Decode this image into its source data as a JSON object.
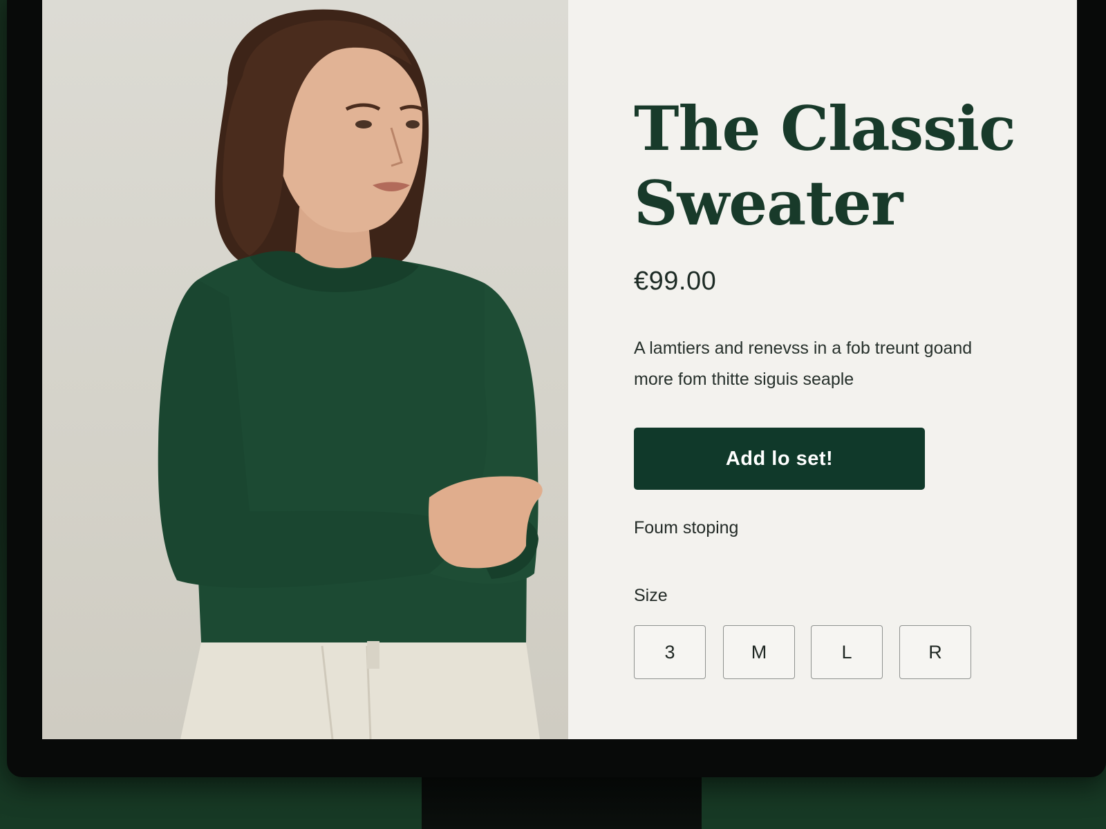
{
  "product": {
    "title": "The Classic Sweater",
    "price": "€99.00",
    "description": "A lamtiers and renevss in a fob treunt goand more fom thitte siguis seaple",
    "add_button_label": "Add lo set!",
    "shipping_text": "Foum stoping",
    "size_label": "Size",
    "sizes": [
      "3",
      "M",
      "L",
      "R"
    ]
  },
  "image": {
    "subject": "model wearing dark green crew-neck sweater and cream trousers"
  },
  "colors": {
    "accent": "#10392a",
    "title_text": "#183a2a",
    "sweater": "#1c4a33",
    "panel_background": "#f3f2ee"
  }
}
